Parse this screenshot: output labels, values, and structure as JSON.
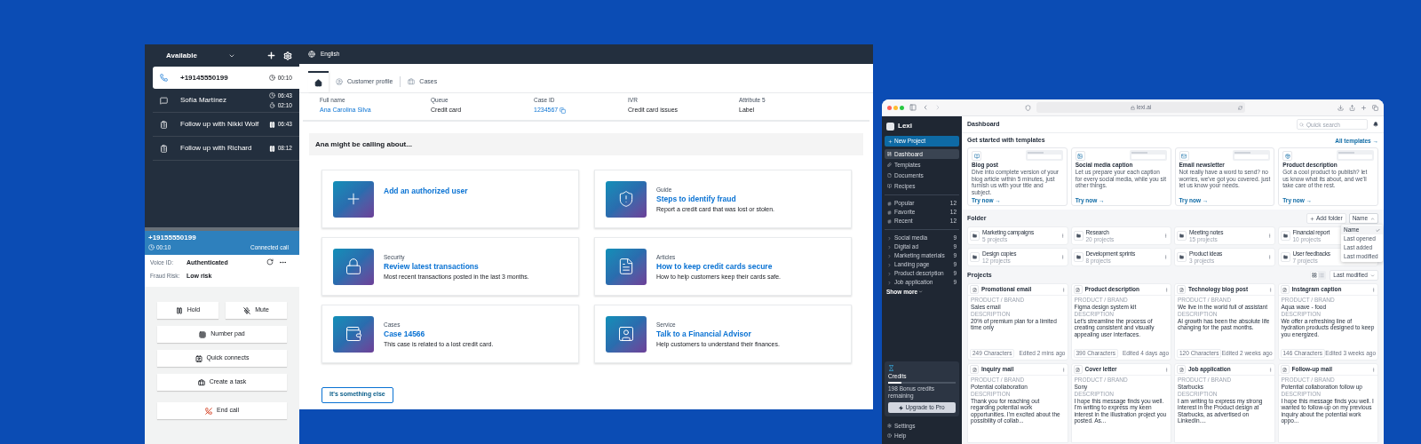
{
  "ccp": {
    "status": "Available",
    "contacts": [
      {
        "kind": "call",
        "label": "+19145550199",
        "selected": true,
        "timers": [
          {
            "kind": "clock",
            "text": "00:10"
          }
        ]
      },
      {
        "kind": "chat",
        "label": "Sofía Martínez",
        "selected": false,
        "timers": [
          {
            "kind": "clock",
            "text": "06:43"
          },
          {
            "kind": "timer",
            "text": "02:10"
          }
        ]
      },
      {
        "kind": "task",
        "label": "Follow up with Nikki Wolf",
        "selected": false,
        "timers": [
          {
            "kind": "paused",
            "text": "06:43"
          }
        ]
      },
      {
        "kind": "task",
        "label": "Follow up with Richard",
        "selected": false,
        "timers": [
          {
            "kind": "paused",
            "text": "08:12"
          }
        ]
      }
    ],
    "active_call": {
      "number": "+19155550199",
      "time": "00:10",
      "status": "Connected call"
    },
    "details": [
      {
        "label": "Voice ID:",
        "value": "Authenticated"
      },
      {
        "label": "Fraud Risk:",
        "value": "Low risk"
      }
    ],
    "button_rows": [
      [
        {
          "kind": "hold",
          "label": "Hold"
        },
        {
          "kind": "mute",
          "label": "Mute"
        }
      ],
      [
        {
          "kind": "numpad",
          "label": "Number pad"
        }
      ],
      [
        {
          "kind": "quick",
          "label": "Quick connects"
        }
      ],
      [
        {
          "kind": "task",
          "label": "Create a task"
        }
      ],
      [
        {
          "kind": "end",
          "label": "End call"
        }
      ]
    ]
  },
  "workspace": {
    "language": "English",
    "tabs": [
      {
        "kind": "home",
        "selected": true
      },
      {
        "kind": "profile",
        "label": "Customer profile",
        "selected": false
      },
      {
        "kind": "cases",
        "label": "Cases",
        "selected": false
      }
    ],
    "attributes": [
      {
        "kind": "link",
        "label": "Full name",
        "value": "Ana Carolina Silva"
      },
      {
        "kind": "text",
        "label": "Queue",
        "value": "Credit card"
      },
      {
        "kind": "copy",
        "label": "Case ID",
        "value": "1234567"
      },
      {
        "kind": "text",
        "label": "IVR",
        "value": "Credit card issues"
      },
      {
        "kind": "text",
        "label": "Attribute 5",
        "value": "Label"
      }
    ],
    "suggestions_title": "Ana might be calling about...",
    "cards": [
      {
        "kind": "add",
        "title": "Add an authorized user"
      },
      {
        "kind": "fraud",
        "category": "Guide",
        "title": "Steps to identify fraud",
        "description": "Report a credit card that was lost or stolen."
      },
      {
        "kind": "lock",
        "category": "Security",
        "title": "Review latest transactions",
        "description": "Most recent transactions posted in the last 3 months."
      },
      {
        "kind": "article",
        "category": "Articles",
        "title": "How to keep credit cards secure",
        "description": "How to help customers keep their cards safe."
      },
      {
        "kind": "wallet",
        "category": "Cases",
        "title": "Case 14566",
        "description": "This case is related to a lost credit card."
      },
      {
        "kind": "advisor",
        "category": "Service",
        "title": "Talk to a Financial Advisor",
        "description": "Help customers to understand their finances."
      }
    ],
    "other_button": "It's something else"
  },
  "browser": {
    "url": "lexi.ai"
  },
  "lexi": {
    "brand": "Lexi",
    "new_project": "New Project",
    "nav": [
      {
        "kind": "dashboard",
        "label": "Dashboard",
        "selected": true
      },
      {
        "kind": "templates",
        "label": "Templates",
        "selected": false
      },
      {
        "kind": "documents",
        "label": "Documents",
        "selected": false
      },
      {
        "kind": "recipes",
        "label": "Recipes",
        "selected": false
      }
    ],
    "tags": [
      {
        "label": "Popular",
        "count": "12"
      },
      {
        "label": "Favorite",
        "count": "12"
      },
      {
        "label": "Recent",
        "count": "12"
      }
    ],
    "folders": [
      {
        "label": "Social media",
        "count": "9"
      },
      {
        "label": "Digital ad",
        "count": "9"
      },
      {
        "label": "Marketing materials",
        "count": "9"
      },
      {
        "label": "Landing page",
        "count": "9"
      },
      {
        "label": "Product description",
        "count": "9"
      },
      {
        "label": "Job application",
        "count": "9"
      }
    ],
    "show_more": "Show more",
    "credits": {
      "title": "Credits",
      "level": 0.2,
      "remaining": "198 Bonus credits remaining",
      "upgrade": "Upgrade to Pro"
    },
    "footer": [
      {
        "kind": "settings",
        "label": "Settings"
      },
      {
        "kind": "help",
        "label": "Help"
      }
    ],
    "page_title": "Dashboard",
    "search": {
      "placeholder": "Quick search"
    },
    "templates": {
      "title": "Get started with templates",
      "all_link": "All templates →",
      "cards": [
        {
          "title": "Blog post",
          "description": "Dive into complete version of your blog article within 5 minutes, just furnish us with your title and subject.",
          "action": "Try now →"
        },
        {
          "title": "Social media caption",
          "description": "Let us prepare your each caption for every social media, while you sit other things.",
          "action": "Try now →"
        },
        {
          "title": "Email newsletter",
          "description": "Not really have a word to send? no worries, we've got you covered. just let us know your needs.",
          "action": "Try now →"
        },
        {
          "title": "Product description",
          "description": "Got a cool product to publish? let us know what its about, and we'll take care of the rest.",
          "action": "Try now →"
        }
      ]
    },
    "folder_section": {
      "title": "Folder",
      "add": "Add folder",
      "sort": "Name",
      "sort_menu": [
        {
          "label": "Name",
          "selected": true
        },
        {
          "label": "Last opened",
          "selected": false
        },
        {
          "label": "Last added",
          "selected": false
        },
        {
          "label": "Last modified",
          "selected": false
        }
      ],
      "folders": [
        {
          "name": "Marketing campaigns",
          "count": "5 projects"
        },
        {
          "name": "Research",
          "count": "20 projects"
        },
        {
          "name": "Meeting notes",
          "count": "15 projects"
        },
        {
          "name": "Financial report",
          "count": "10 projects"
        },
        {
          "name": "Design copies",
          "count": "12 projects"
        },
        {
          "name": "Development sprints",
          "count": "8 projects"
        },
        {
          "name": "Product ideas",
          "count": "3 projects"
        },
        {
          "name": "User feedbacks",
          "count": "7 projects"
        }
      ]
    },
    "projects": {
      "title": "Projects",
      "sort": "Last modified",
      "cards": [
        {
          "name": "Promotional email",
          "brand_label": "PRODUCT / BRAND",
          "brand": "Sales email",
          "description_label": "DESCRIPTION",
          "description": "20% of premium plan for a limited time only",
          "characters": "249 Characters",
          "edited": "Edited 2 mins ago"
        },
        {
          "name": "Product description",
          "brand_label": "PRODUCT / BRAND",
          "brand": "Figma design system kit",
          "description_label": "DESCRIPTION",
          "description": "Let's streamline the process of creating consistent and visually appealing user interfaces.",
          "characters": "390 Characters",
          "edited": "Edited 4 days ago"
        },
        {
          "name": "Technology blog post",
          "brand_label": "PRODUCT / BRAND",
          "brand": "We live in the world full of assistant",
          "description_label": "DESCRIPTION",
          "description": "AI growth has been the absolute life changing for the past months.",
          "characters": "120 Characters",
          "edited": "Edited 2 weeks ago"
        },
        {
          "name": "Instagram caption",
          "brand_label": "PRODUCT / BRAND",
          "brand": "Aqua wave - food",
          "description_label": "DESCRIPTION",
          "description": "We offer a refreshing line of hydration products designed to keep you energized.",
          "characters": "146 Characters",
          "edited": "Edited 3 weeks ago"
        },
        {
          "name": "Inquiry mail",
          "brand_label": "PRODUCT / BRAND",
          "brand": "Potential collaboration",
          "description_label": "DESCRIPTION",
          "description": "Thank you for reaching out regarding potential work opportunities. I'm excited about the possibility of collab..."
        },
        {
          "name": "Cover letter",
          "brand_label": "PRODUCT / BRAND",
          "brand": "Sony",
          "description_label": "DESCRIPTION",
          "description": "I hope this message finds you well. I'm writing to express my keen interest in the illustration project you posted. As..."
        },
        {
          "name": "Job application",
          "brand_label": "PRODUCT / BRAND",
          "brand": "Starbucks",
          "description_label": "DESCRIPTION",
          "description": "I am writing to express my strong interest in the Product design at Starbucks, as advertised on LinkedIn...."
        },
        {
          "name": "Follow-up mail",
          "brand_label": "PRODUCT / BRAND",
          "brand": "Potential collaboration follow up",
          "description_label": "DESCRIPTION",
          "description": "I hope this message finds you well. I wanted to follow-up on my previous inquiry about the potential work oppo..."
        }
      ]
    }
  }
}
